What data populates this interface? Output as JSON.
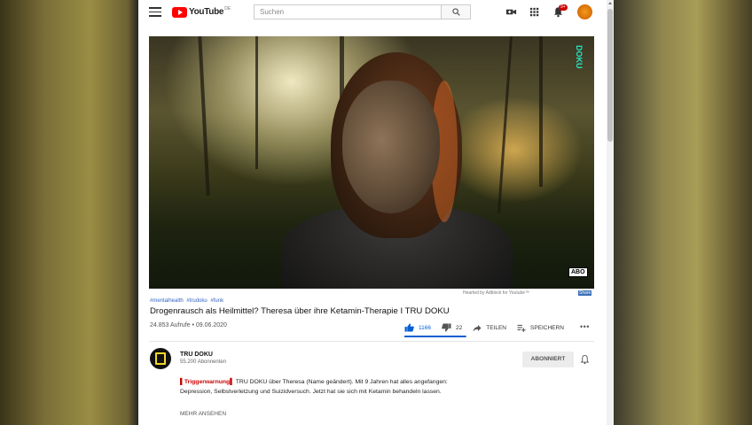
{
  "topbar": {
    "logo_text": "YouTube",
    "logo_region": "DE",
    "search_placeholder": "Suchen",
    "notification_count": "9+"
  },
  "player": {
    "watermark": "DOKU",
    "abo_badge": "ABO"
  },
  "adblock": {
    "note": "Hearted by Adblock for Youtube™",
    "share": "Share"
  },
  "video": {
    "hashtags": [
      "#mentalhealth",
      "#trudoku",
      "#funk"
    ],
    "title": "Drogenrausch als Heilmittel? Theresa über ihre Ketamin-Therapie I TRU DOKU",
    "views_date": "24.853 Aufrufe • 09.06.2020",
    "likes": "1166",
    "dislikes": "22",
    "like_ratio": 0.98,
    "share_label": "TEILEN",
    "save_label": "SPEICHERN"
  },
  "channel": {
    "name": "TRU DOKU",
    "subscribers": "55.200 Abonnenten",
    "subscribe_label": "ABONNIERT"
  },
  "description": {
    "warning": "Triggerwarnung",
    "line1_rest": "TRU DOKU über Theresa (Name geändert). Mit 9 Jahren hat alles angefangen:",
    "line2": "Depression, Selbstverletzung und Suizidversuch. Jetzt hat sie sich mit Ketamin behandeln lassen.",
    "show_more": "MEHR ANSEHEN"
  },
  "colors": {
    "accent_blue": "#065fd4",
    "brand_red": "#ff0000",
    "watermark_teal": "#21e8c8"
  }
}
